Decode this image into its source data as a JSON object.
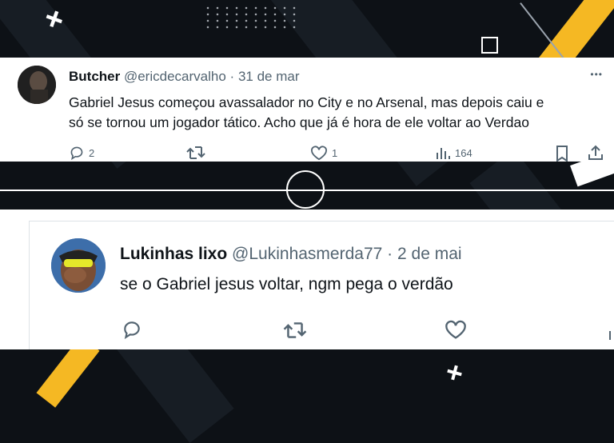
{
  "tweet1": {
    "name": "Butcher",
    "handle": "@ericdecarvalho",
    "sep": "·",
    "date": "31 de mar",
    "more": "•••",
    "text_line1": "Gabriel Jesus começou avassalador no City e no Arsenal, mas depois caiu e",
    "text_line2": "só se tornou um jogador tático. Acho que já é hora de ele voltar ao Verdao",
    "replies": "2",
    "likes": "1",
    "views": "164",
    "icons": [
      "reply-icon",
      "retweet-icon",
      "like-icon",
      "views-icon",
      "bookmark-icon",
      "share-icon"
    ]
  },
  "tweet2": {
    "name": "Lukinhas lixo",
    "handle": "@Lukinhasmerda77",
    "sep": "·",
    "date": "2 de mai",
    "text": "se o Gabriel jesus voltar, ngm pega o verdão",
    "icons": [
      "reply-icon",
      "retweet-icon",
      "like-icon",
      "views-icon"
    ]
  },
  "colors": {
    "background": "#0d1116",
    "accent_yellow": "#f5b823",
    "card": "#ffffff",
    "text_primary": "#0f1419",
    "text_secondary": "#536471"
  }
}
